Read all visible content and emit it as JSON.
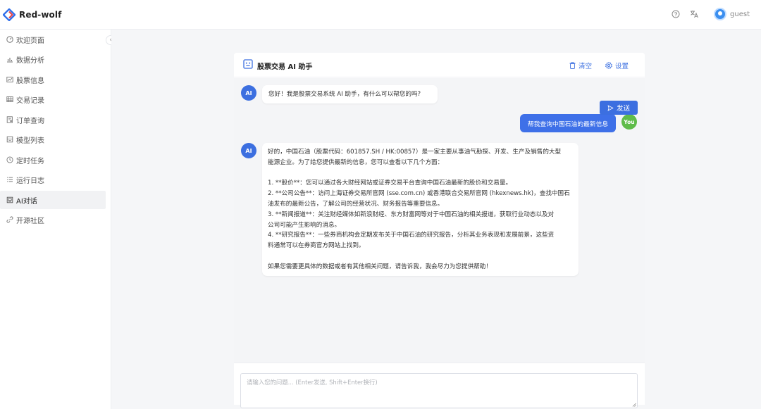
{
  "app": {
    "name": "Red-wolf"
  },
  "header": {
    "help_icon": "help-circle-icon",
    "lang_icon": "translate-icon",
    "user": "guest"
  },
  "sidebar": {
    "items": [
      {
        "label": "欢迎页面",
        "icon": "dashboard-icon"
      },
      {
        "label": "数据分析",
        "icon": "bar-chart-icon"
      },
      {
        "label": "股票信息",
        "icon": "line-chart-icon"
      },
      {
        "label": "交易记录",
        "icon": "table-icon"
      },
      {
        "label": "订单查询",
        "icon": "file-search-icon"
      },
      {
        "label": "模型列表",
        "icon": "box-icon"
      },
      {
        "label": "定时任务",
        "icon": "clock-icon"
      },
      {
        "label": "运行日志",
        "icon": "list-icon"
      },
      {
        "label": "AI对话",
        "icon": "robot-icon",
        "active": true
      },
      {
        "label": "开源社区",
        "icon": "link-icon"
      }
    ],
    "collapse": "‹"
  },
  "chat": {
    "title": "股票交易 AI 助手",
    "clear_label": "清空",
    "settings_label": "设置",
    "ai_avatar": "AI",
    "user_avatar": "You",
    "messages": {
      "greeting": "您好！我是股票交易系统 AI 助手，有什么可以帮您的吗?",
      "user_question": "帮我查询中国石油的最新信息",
      "answer_lines": [
        "好的，中国石油（股票代码：601857.SH / HK:00857）是一家主要从事油气勘探、开发、生产及销售的大型",
        "能源企业。为了给您提供最新的信息，您可以查看以下几个方面：",
        "",
        "1. **股价**：您可以通过各大财经网站或证券交易平台查询中国石油最新的股价和交易量。",
        "2. **公司公告**：访问上海证券交易所官网 (sse.com.cn) 或香港联合交易所官网 (hkexnews.hk)，查找中国石",
        "油发布的最新公告，了解公司的经营状况、财务报告等重要信息。",
        "3. **新闻报道**：关注财经媒体如新浪财经、东方财富网等对于中国石油的相关报道，获取行业动态以及对",
        "公司可能产生影响的消息。",
        "4. **研究报告**：一些券商机构会定期发布关于中国石油的研究报告，分析其业务表现和发展前景，这些资",
        "料通常可以在券商官方网站上找到。",
        "",
        "如果您需要更具体的数据或者有其他相关问题，请告诉我，我会尽力为您提供帮助！"
      ]
    },
    "input": {
      "placeholder": "请输入您的问题... (Enter发送, Shift+Enter换行)",
      "value": ""
    },
    "send_label": "发送"
  }
}
